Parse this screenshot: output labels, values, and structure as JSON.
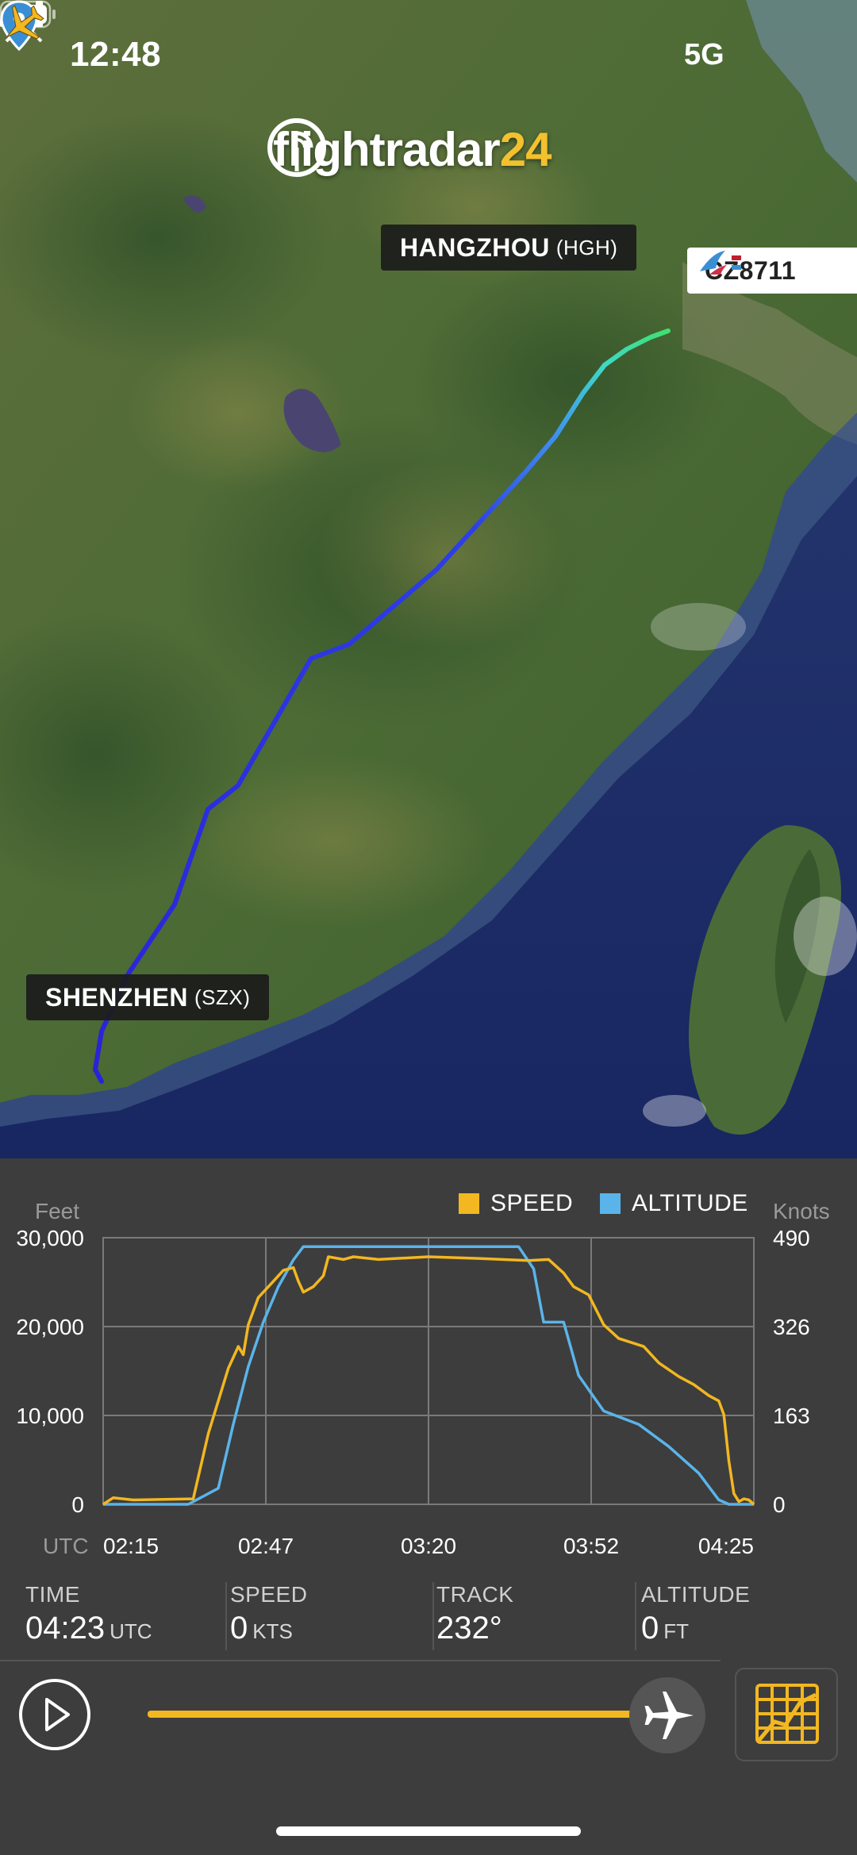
{
  "status_bar": {
    "time": "12:48",
    "network": "5G"
  },
  "brand": {
    "name": "flightradar",
    "number": "24"
  },
  "map": {
    "origin": {
      "city": "SHENZHEN",
      "code": "(SZX)"
    },
    "destination": {
      "city": "HANGZHOU",
      "code": "(HGH)"
    },
    "flight_number": "CZ8711"
  },
  "chart": {
    "legend": {
      "speed": "SPEED",
      "altitude": "ALTITUDE"
    },
    "left_axis_title": "Feet",
    "right_axis_title": "Knots",
    "x_axis_title": "UTC"
  },
  "chart_data": {
    "type": "line",
    "x_ticks": [
      "02:15",
      "02:47",
      "03:20",
      "03:52",
      "04:25"
    ],
    "y_left_ticks": [
      "30,000",
      "20,000",
      "10,000",
      "0"
    ],
    "y_right_ticks": [
      "490",
      "326",
      "163",
      "0"
    ],
    "ylim_left": [
      0,
      30000
    ],
    "ylim_right": [
      0,
      490
    ],
    "xlim": [
      "02:15",
      "04:25"
    ],
    "series": [
      {
        "name": "SPEED",
        "color": "#f2b721",
        "axis": "right",
        "x": [
          "02:15",
          "02:17",
          "02:21",
          "02:33",
          "02:36",
          "02:40",
          "02:42",
          "02:43",
          "02:44",
          "02:46",
          "02:49",
          "02:51",
          "02:53",
          "02:54",
          "02:55",
          "02:57",
          "02:59",
          "03:00",
          "03:03",
          "03:05",
          "03:10",
          "03:20",
          "03:30",
          "03:40",
          "03:44",
          "03:47",
          "03:49",
          "03:52",
          "03:55",
          "03:58",
          "04:03",
          "04:06",
          "04:10",
          "04:13",
          "04:16",
          "04:18",
          "04:19",
          "04:20",
          "04:21",
          "04:22",
          "04:23",
          "04:24",
          "04:25"
        ],
        "values": [
          0,
          12,
          8,
          10,
          130,
          250,
          290,
          275,
          330,
          380,
          410,
          430,
          435,
          410,
          390,
          400,
          420,
          455,
          450,
          455,
          450,
          455,
          452,
          448,
          450,
          425,
          400,
          385,
          330,
          305,
          290,
          260,
          235,
          220,
          200,
          190,
          165,
          80,
          20,
          5,
          10,
          8,
          0
        ]
      },
      {
        "name": "ALTITUDE",
        "color": "#5ab4ea",
        "axis": "left",
        "x": [
          "02:15",
          "02:32",
          "02:38",
          "02:41",
          "02:44",
          "02:47",
          "02:50",
          "02:53",
          "02:55",
          "02:58",
          "03:10",
          "03:20",
          "03:35",
          "03:38",
          "03:41",
          "03:43",
          "03:47",
          "03:50",
          "03:55",
          "04:02",
          "04:08",
          "04:14",
          "04:18",
          "04:20",
          "04:22",
          "04:25"
        ],
        "values": [
          0,
          0,
          1800,
          9000,
          15500,
          20500,
          24500,
          27500,
          29000,
          29000,
          29000,
          29000,
          29000,
          29000,
          26500,
          20500,
          20500,
          14500,
          10500,
          9000,
          6500,
          3500,
          500,
          0,
          0,
          0
        ]
      }
    ]
  },
  "info": {
    "time": {
      "label": "TIME",
      "value": "04:23",
      "unit": "UTC"
    },
    "speed": {
      "label": "SPEED",
      "value": "0",
      "unit": "KTS"
    },
    "track": {
      "label": "TRACK",
      "value": "232°"
    },
    "altitude": {
      "label": "ALTITUDE",
      "value": "0",
      "unit": "FT"
    }
  },
  "playback": {
    "progress": 0.98
  },
  "colors": {
    "speed": "#f2b721",
    "altitude": "#5ab4ea",
    "panel": "#3d3d3d",
    "route": "#2a2be0"
  }
}
